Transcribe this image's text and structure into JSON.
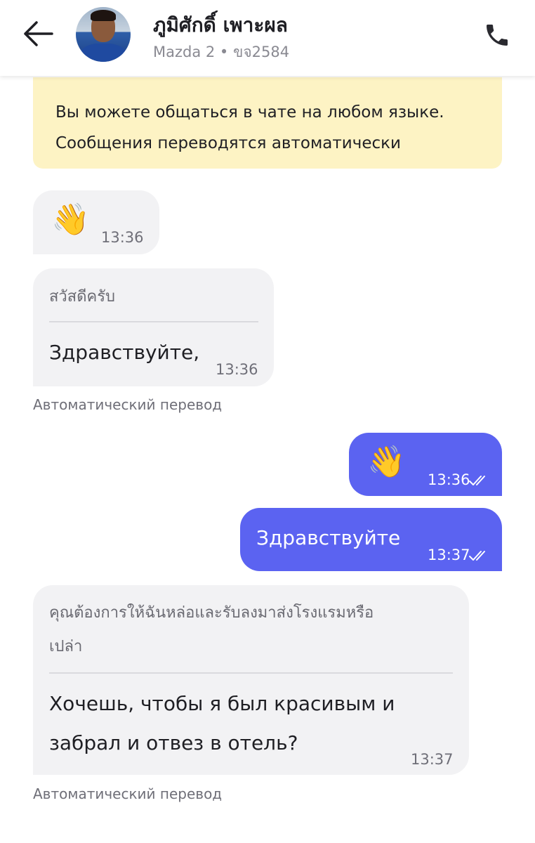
{
  "header": {
    "contact_name": "ภูมิศักดิ์ เพาะผล",
    "car_info": "Mazda 2 • ขจ2584"
  },
  "notice": {
    "line1": "Вы можете общаться в чате на любом языке.",
    "line2": "Сообщения переводятся автоматически"
  },
  "messages": [
    {
      "direction": "incoming",
      "emoji": "👋",
      "time": "13:36"
    },
    {
      "direction": "incoming",
      "original": "สวัสดีครับ",
      "translation": "Здравствуйте,",
      "time": "13:36",
      "note": "Автоматический перевод"
    },
    {
      "direction": "outgoing",
      "emoji": "👋",
      "time": "13:36",
      "status": "read"
    },
    {
      "direction": "outgoing",
      "text": "Здравствуйте",
      "time": "13:37",
      "status": "read"
    },
    {
      "direction": "incoming",
      "original_lines": [
        "คุณต้องการให้ฉันหล่อและรับลงมาส่งโรงแรมหรือ",
        "เปล่า"
      ],
      "translation_lines": [
        "Хочешь, чтобы я был красивым и",
        "забрал и отвез в отель?"
      ],
      "time": "13:37",
      "note": "Автоматический перевод"
    }
  ],
  "colors": {
    "outgoing_bubble": "#5b63f1",
    "incoming_bubble": "#f2f2f4",
    "notice_background": "#fdf3c4"
  },
  "icons": [
    "arrow-left-icon",
    "phone-icon",
    "double-check-icon"
  ]
}
